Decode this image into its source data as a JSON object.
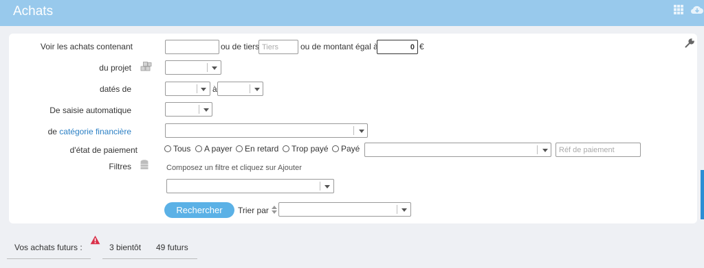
{
  "header": {
    "title": "Achats",
    "icons": [
      "grid-icon",
      "cloud-download-icon"
    ]
  },
  "form": {
    "row_contains": {
      "label": "Voir les achats contenant",
      "contains_value": "",
      "tiers_sep": "ou de tiers",
      "tiers_placeholder": "Tiers",
      "amount_sep": "ou de montant égal à",
      "amount_value": "0",
      "currency": "€"
    },
    "row_project": {
      "label": "du projet",
      "icon": "cubes-icon",
      "value": ""
    },
    "row_dates": {
      "label": "datés de",
      "between": "à",
      "from": "",
      "to": ""
    },
    "row_auto": {
      "label": "De saisie automatique",
      "value": ""
    },
    "row_category": {
      "label_prefix": "de",
      "label_link": "catégorie financière",
      "value": ""
    },
    "row_payment": {
      "label": "d'état de paiement",
      "options": [
        "Tous",
        "A payer",
        "En retard",
        "Trop payé",
        "Payé"
      ],
      "select_value": "",
      "ref_placeholder": "Réf de paiement"
    },
    "row_filters": {
      "label": "Filtres",
      "icon": "database-icon",
      "hint": "Composez un filtre et cliquez sur Ajouter",
      "value": ""
    },
    "actions": {
      "search_label": "Rechercher",
      "sort_label": "Trier par",
      "sort_value": ""
    },
    "settings_icon": "wrench-icon"
  },
  "footer": {
    "label": "Vos achats futurs :",
    "alert_icon": "warning-icon",
    "alert_color": "#d9304a",
    "soon": "3 bientôt",
    "future": "49 futurs"
  },
  "colors": {
    "header_bg": "#98c9ec",
    "primary": "#5bb1e6",
    "link": "#2a7fc4"
  }
}
